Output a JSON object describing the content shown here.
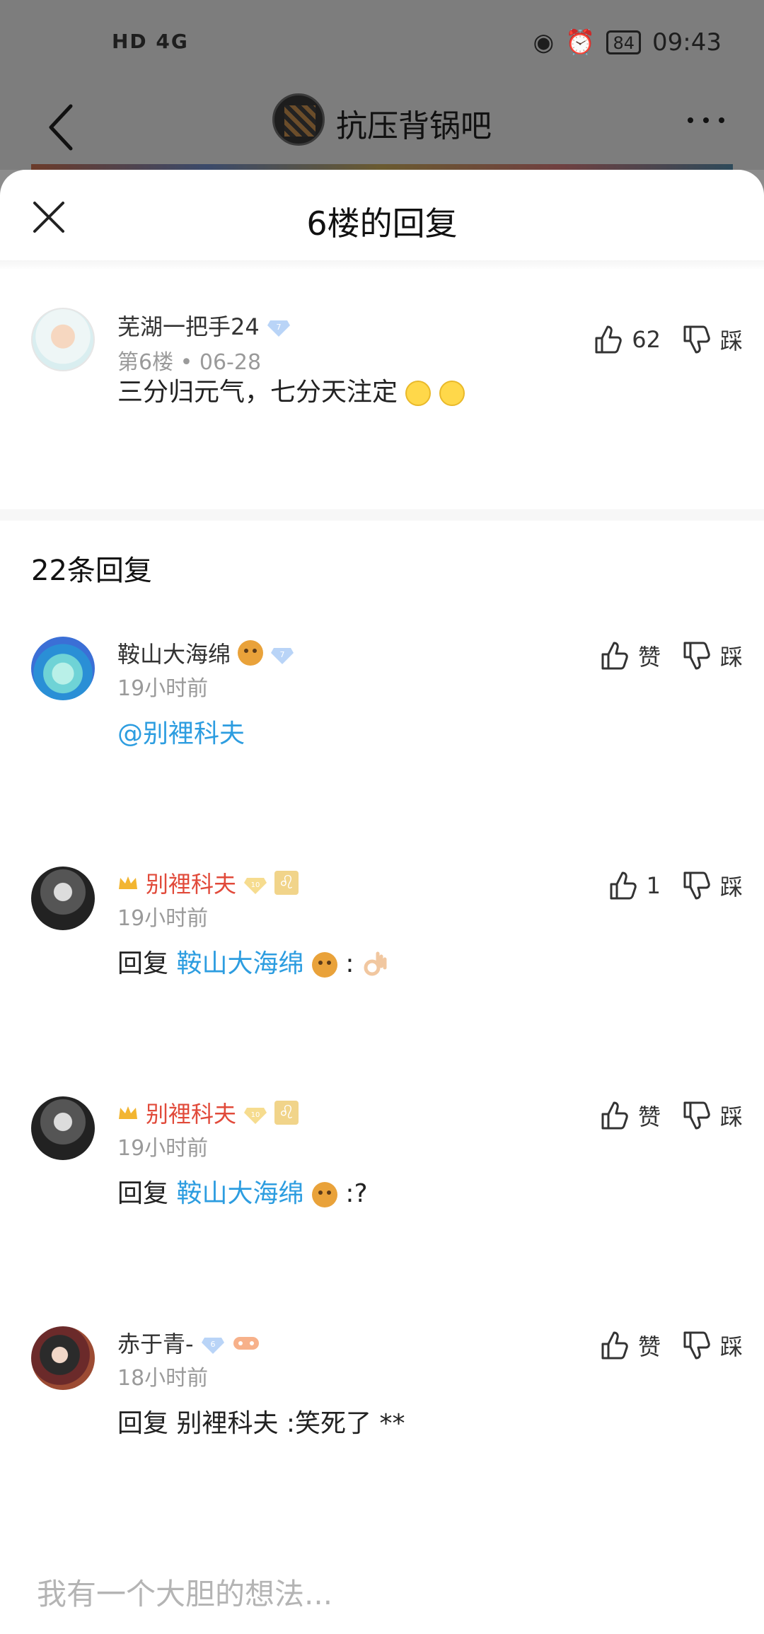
{
  "status_bar": {
    "network_left": "HD 4G",
    "battery": "84",
    "time": "09:43"
  },
  "topbar": {
    "forum_name": "抗压背锅吧"
  },
  "sheet": {
    "title": "6楼的回复",
    "main_comment": {
      "username": "芜湖一把手24",
      "level_badge": "7",
      "meta": "第6楼 • 06-28",
      "likes": "62",
      "dislike_label": "踩",
      "text": "三分归元气，七分天注定"
    },
    "reply_count": "22条回复",
    "replies": [
      {
        "username": "鞍山大海绵",
        "level_badge": "7",
        "time": "19小时前",
        "like_label": "赞",
        "dislike_label": "踩",
        "text_link": "@别裡科夫"
      },
      {
        "username": "别裡科夫",
        "level_badge": "10",
        "time": "19小时前",
        "like_label": "1",
        "dislike_label": "踩",
        "text_prefix": "回复",
        "text_link": "鞍山大海绵",
        "text_suffix": ":"
      },
      {
        "username": "别裡科夫",
        "level_badge": "10",
        "time": "19小时前",
        "like_label": "赞",
        "dislike_label": "踩",
        "text_prefix": "回复",
        "text_link": "鞍山大海绵",
        "text_suffix": ":?"
      },
      {
        "username": "赤于青-",
        "level_badge": "6",
        "time": "18小时前",
        "like_label": "赞",
        "dislike_label": "踩",
        "text": "回复 别裡科夫 :笑死了 **"
      }
    ],
    "input_placeholder": "我有一个大胆的想法..."
  },
  "colors": {
    "link": "#2d9de0",
    "vip_name": "#e14a3a",
    "muted": "#9a9a9a"
  }
}
